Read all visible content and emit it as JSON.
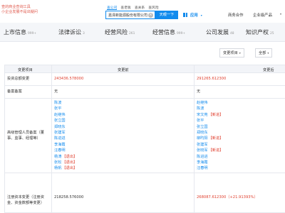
{
  "header": {
    "logo_line1": "查的商业查询工具",
    "logo_line2": "小企业发展不是出疑问",
    "scope_tabs": [
      "查公司",
      "查老板",
      "查关系",
      "查风险"
    ],
    "search_value": "嘉泽新能源股份有限公司",
    "search_button": "天眼一下",
    "app_label": "应用",
    "link_business": "商务合作",
    "link_enterprise": "企业级产品"
  },
  "tabs": [
    {
      "label": "上市信息",
      "count": "999+"
    },
    {
      "label": "法律诉讼",
      "count": "3"
    },
    {
      "label": "经营风险",
      "count": "261"
    },
    {
      "label": "经营信息",
      "count": "999+"
    },
    {
      "label": "公司发展",
      "count": "48"
    },
    {
      "label": "知识产权",
      "count": "25"
    }
  ],
  "filters": {
    "type": "变更项目",
    "period": "全部"
  },
  "table": {
    "headers": {
      "item": "变更项目",
      "before": "变更前",
      "after": "变更后"
    },
    "rows": [
      {
        "item": "投资总额变更",
        "before": "243436.578000",
        "after": "291265.612300"
      },
      {
        "item": "备案备案",
        "before": "无",
        "after": "无"
      },
      {
        "item_lines": [
          "高级管理人员备案（董",
          "事、监事、经理等）"
        ],
        "before_names": [
          {
            "name": "陈波",
            "tag": ""
          },
          {
            "name": "张平",
            "tag": ""
          },
          {
            "name": "赵继伟",
            "tag": ""
          },
          {
            "name": "张立国",
            "tag": ""
          },
          {
            "name": "郑晓东",
            "tag": ""
          },
          {
            "name": "张建军",
            "tag": ""
          },
          {
            "name": "陈进进",
            "tag": ""
          },
          {
            "name": "李海霞",
            "tag": ""
          },
          {
            "name": "汪春明",
            "tag": ""
          },
          {
            "name": "杨涛",
            "tag": "【退出】"
          },
          {
            "name": "张松",
            "tag": "【退出】"
          },
          {
            "name": "杨帆",
            "tag": "【退出】"
          }
        ],
        "after_names": [
          {
            "name": "赵继伟",
            "tag": ""
          },
          {
            "name": "陈波",
            "tag": ""
          },
          {
            "name": "宋文苑",
            "tag": "【新进】"
          },
          {
            "name": "张平",
            "tag": ""
          },
          {
            "name": "张立国",
            "tag": ""
          },
          {
            "name": "郑晓东",
            "tag": ""
          },
          {
            "name": "柳旳阳",
            "tag": "【新进】"
          },
          {
            "name": "张建军",
            "tag": ""
          },
          {
            "name": "张晓军",
            "tag": "【新进】"
          },
          {
            "name": "陈进进",
            "tag": ""
          },
          {
            "name": "李海霞",
            "tag": ""
          },
          {
            "name": "汪春明",
            "tag": ""
          }
        ]
      },
      {
        "item_lines": [
          "注册资本变更（注册资",
          "金、资金数额等变更）"
        ],
        "before": "218258.576000",
        "after": "268087.612300",
        "after_change": "（+21.91393%）"
      }
    ]
  },
  "colors": {
    "accent": "#128bed",
    "red": "#e0402f",
    "tab_bg": "#f4f6f9"
  }
}
